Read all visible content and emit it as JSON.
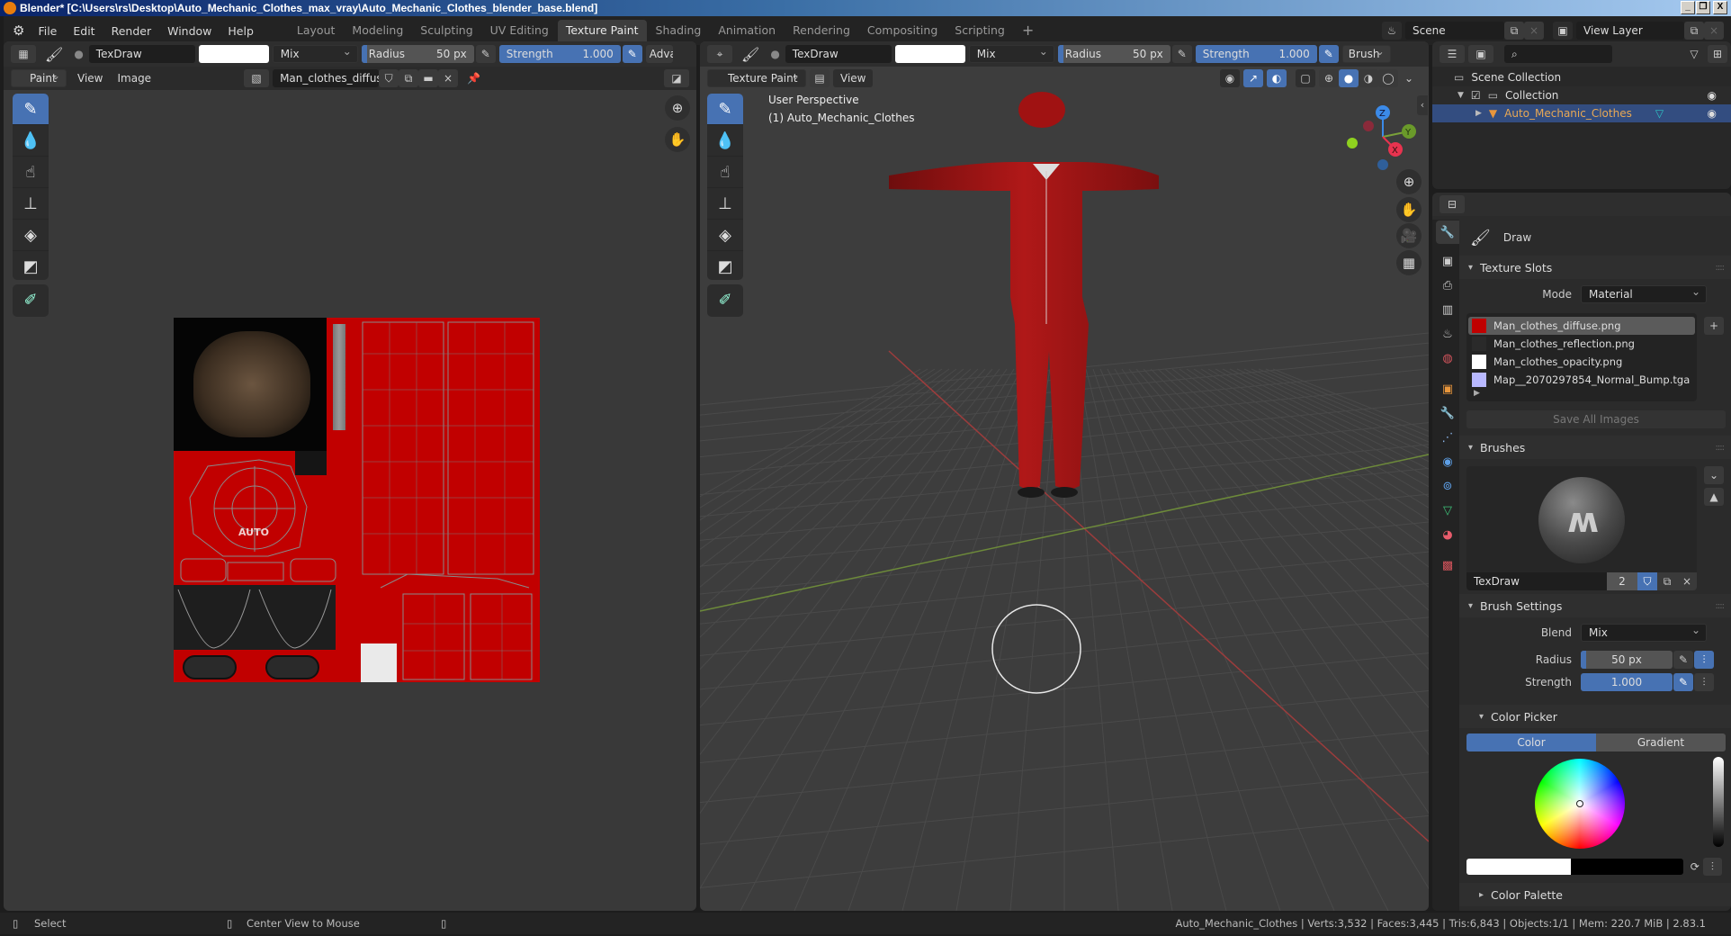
{
  "window": {
    "title": "Blender* [C:\\Users\\rs\\Desktop\\Auto_Mechanic_Clothes_max_vray\\Auto_Mechanic_Clothes_blender_base.blend]",
    "controls": {
      "minimize": "_",
      "restore": "❐",
      "close": "X"
    }
  },
  "menubar": {
    "menus": [
      "File",
      "Edit",
      "Render",
      "Window",
      "Help"
    ],
    "workspaces": [
      "Layout",
      "Modeling",
      "Sculpting",
      "UV Editing",
      "Texture Paint",
      "Shading",
      "Animation",
      "Rendering",
      "Compositing",
      "Scripting"
    ],
    "active_workspace": "Texture Paint",
    "add_workspace": "+",
    "scene": "Scene",
    "view_layer": "View Layer"
  },
  "image_editor": {
    "tool_header": {
      "brush_name": "TexDraw",
      "blend": "Mix",
      "radius_label": "Radius",
      "radius_value": "50 px",
      "strength_label": "Strength",
      "strength_value": "1.000",
      "advanced": "Adva"
    },
    "header": {
      "mode": "Paint",
      "menus": [
        "View",
        "Image"
      ],
      "image_name": "Man_clothes_diffuse...",
      "texture_label": "AUTO"
    },
    "tools": [
      "draw",
      "soften",
      "smear",
      "clone",
      "fill",
      "mask",
      "annotate"
    ]
  },
  "viewport": {
    "tool_header": {
      "brush_name": "TexDraw",
      "blend": "Mix",
      "radius_label": "Radius",
      "radius_value": "50 px",
      "strength_label": "Strength",
      "strength_value": "1.000",
      "brush_menu": "Brush"
    },
    "header": {
      "mode": "Texture Paint",
      "menus": [
        "View"
      ]
    },
    "overlay_text": {
      "perspective": "User Perspective",
      "object": "(1) Auto_Mechanic_Clothes"
    },
    "gizmo": {
      "x": "X",
      "y": "Y",
      "z": "Z"
    }
  },
  "outliner": {
    "search_placeholder": "",
    "items": [
      {
        "label": "Scene Collection",
        "level": 0
      },
      {
        "label": "Collection",
        "level": 1
      },
      {
        "label": "Auto_Mechanic_Clothes",
        "level": 2,
        "selected": true
      }
    ]
  },
  "properties": {
    "tool_name": "Draw",
    "texture_slots": {
      "title": "Texture Slots",
      "mode_label": "Mode",
      "mode_value": "Material",
      "slots": [
        {
          "name": "Man_clothes_diffuse.png",
          "color": "#c00000",
          "active": true
        },
        {
          "name": "Man_clothes_reflection.png",
          "color": "#2a2a2a",
          "active": false
        },
        {
          "name": "Man_clothes_opacity.png",
          "color": "#ffffff",
          "active": false
        },
        {
          "name": "Map__2070297854_Normal_Bump.tga",
          "color": "#b8b8ff",
          "active": false
        }
      ],
      "save_all": "Save All Images"
    },
    "brushes": {
      "title": "Brushes",
      "brush_name": "TexDraw",
      "users": "2"
    },
    "brush_settings": {
      "title": "Brush Settings",
      "blend_label": "Blend",
      "blend_value": "Mix",
      "radius_label": "Radius",
      "radius_value": "50 px",
      "strength_label": "Strength",
      "strength_value": "1.000"
    },
    "color_picker": {
      "title": "Color Picker",
      "tabs": [
        "Color",
        "Gradient"
      ],
      "active_tab": "Color",
      "primary_color": "#ffffff",
      "secondary_color": "#000000"
    },
    "color_palette": {
      "title": "Color Palette"
    }
  },
  "statusbar": {
    "left": [
      "Select",
      "Center View to Mouse"
    ],
    "right": "Auto_Mechanic_Clothes | Verts:3,532 | Faces:3,445 | Tris:6,843 | Objects:1/1 | Mem: 220.7 MiB | 2.83.1"
  }
}
